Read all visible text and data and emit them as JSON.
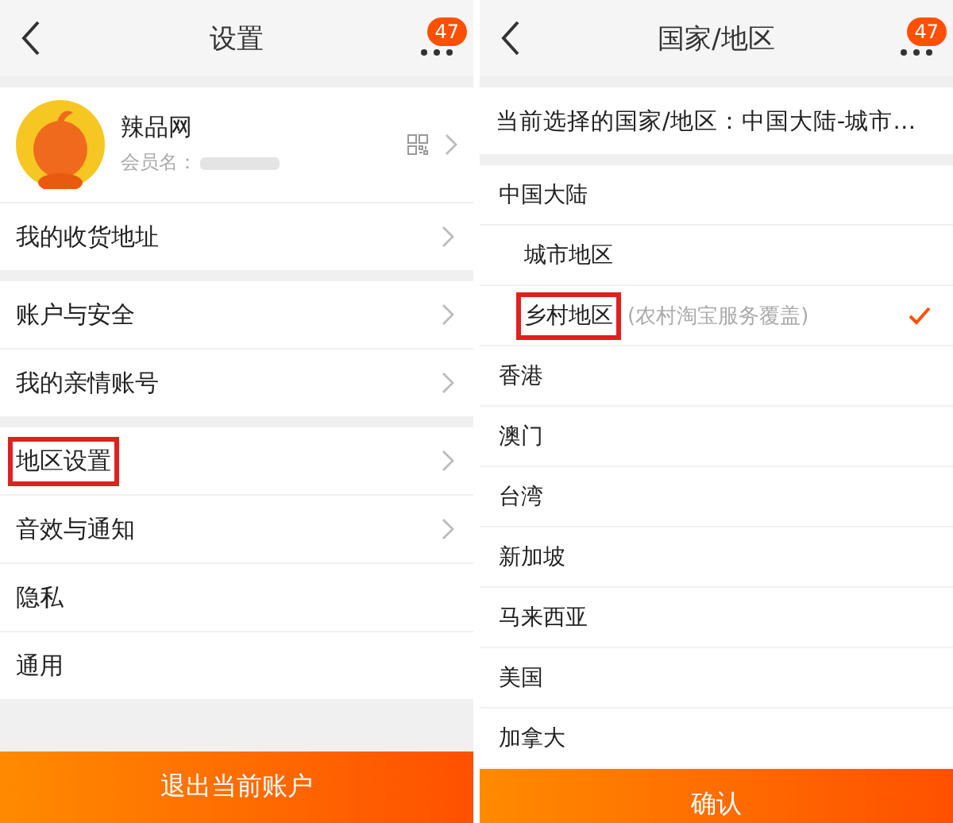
{
  "settings_screen": {
    "title": "设置",
    "badge": "47",
    "profile": {
      "name": "辣品网",
      "member_label": "会员名："
    },
    "groups": [
      [
        {
          "label": "我的收货地址",
          "annotated": false
        }
      ],
      [
        {
          "label": "账户与安全",
          "annotated": false
        },
        {
          "label": "我的亲情账号",
          "annotated": false
        }
      ],
      [
        {
          "label": "地区设置",
          "annotated": true
        },
        {
          "label": "音效与通知",
          "annotated": false,
          "chevron": true
        },
        {
          "label": "隐私",
          "annotated": false,
          "chevron": false
        },
        {
          "label": "通用",
          "annotated": false,
          "chevron": false
        }
      ]
    ],
    "bottom_button": "退出当前账户"
  },
  "region_screen": {
    "title": "国家/地区",
    "badge": "47",
    "current": "当前选择的国家/地区：中国大陆-城市…",
    "regions": [
      {
        "label": "中国大陆",
        "selected": false,
        "annotated": false,
        "children": [
          {
            "label": "城市地区",
            "selected": false,
            "annotated": false
          },
          {
            "label": "乡村地区",
            "note": "(农村淘宝服务覆盖)",
            "selected": true,
            "annotated": true
          }
        ]
      },
      {
        "label": "香港",
        "selected": false,
        "annotated": false
      },
      {
        "label": "澳门",
        "selected": false,
        "annotated": false
      },
      {
        "label": "台湾",
        "selected": false,
        "annotated": false
      },
      {
        "label": "新加坡",
        "selected": false,
        "annotated": false
      },
      {
        "label": "马来西亚",
        "selected": false,
        "annotated": false
      },
      {
        "label": "美国",
        "selected": false,
        "annotated": false
      },
      {
        "label": "加拿大",
        "selected": false,
        "annotated": false
      }
    ],
    "bottom_button": "确认"
  }
}
